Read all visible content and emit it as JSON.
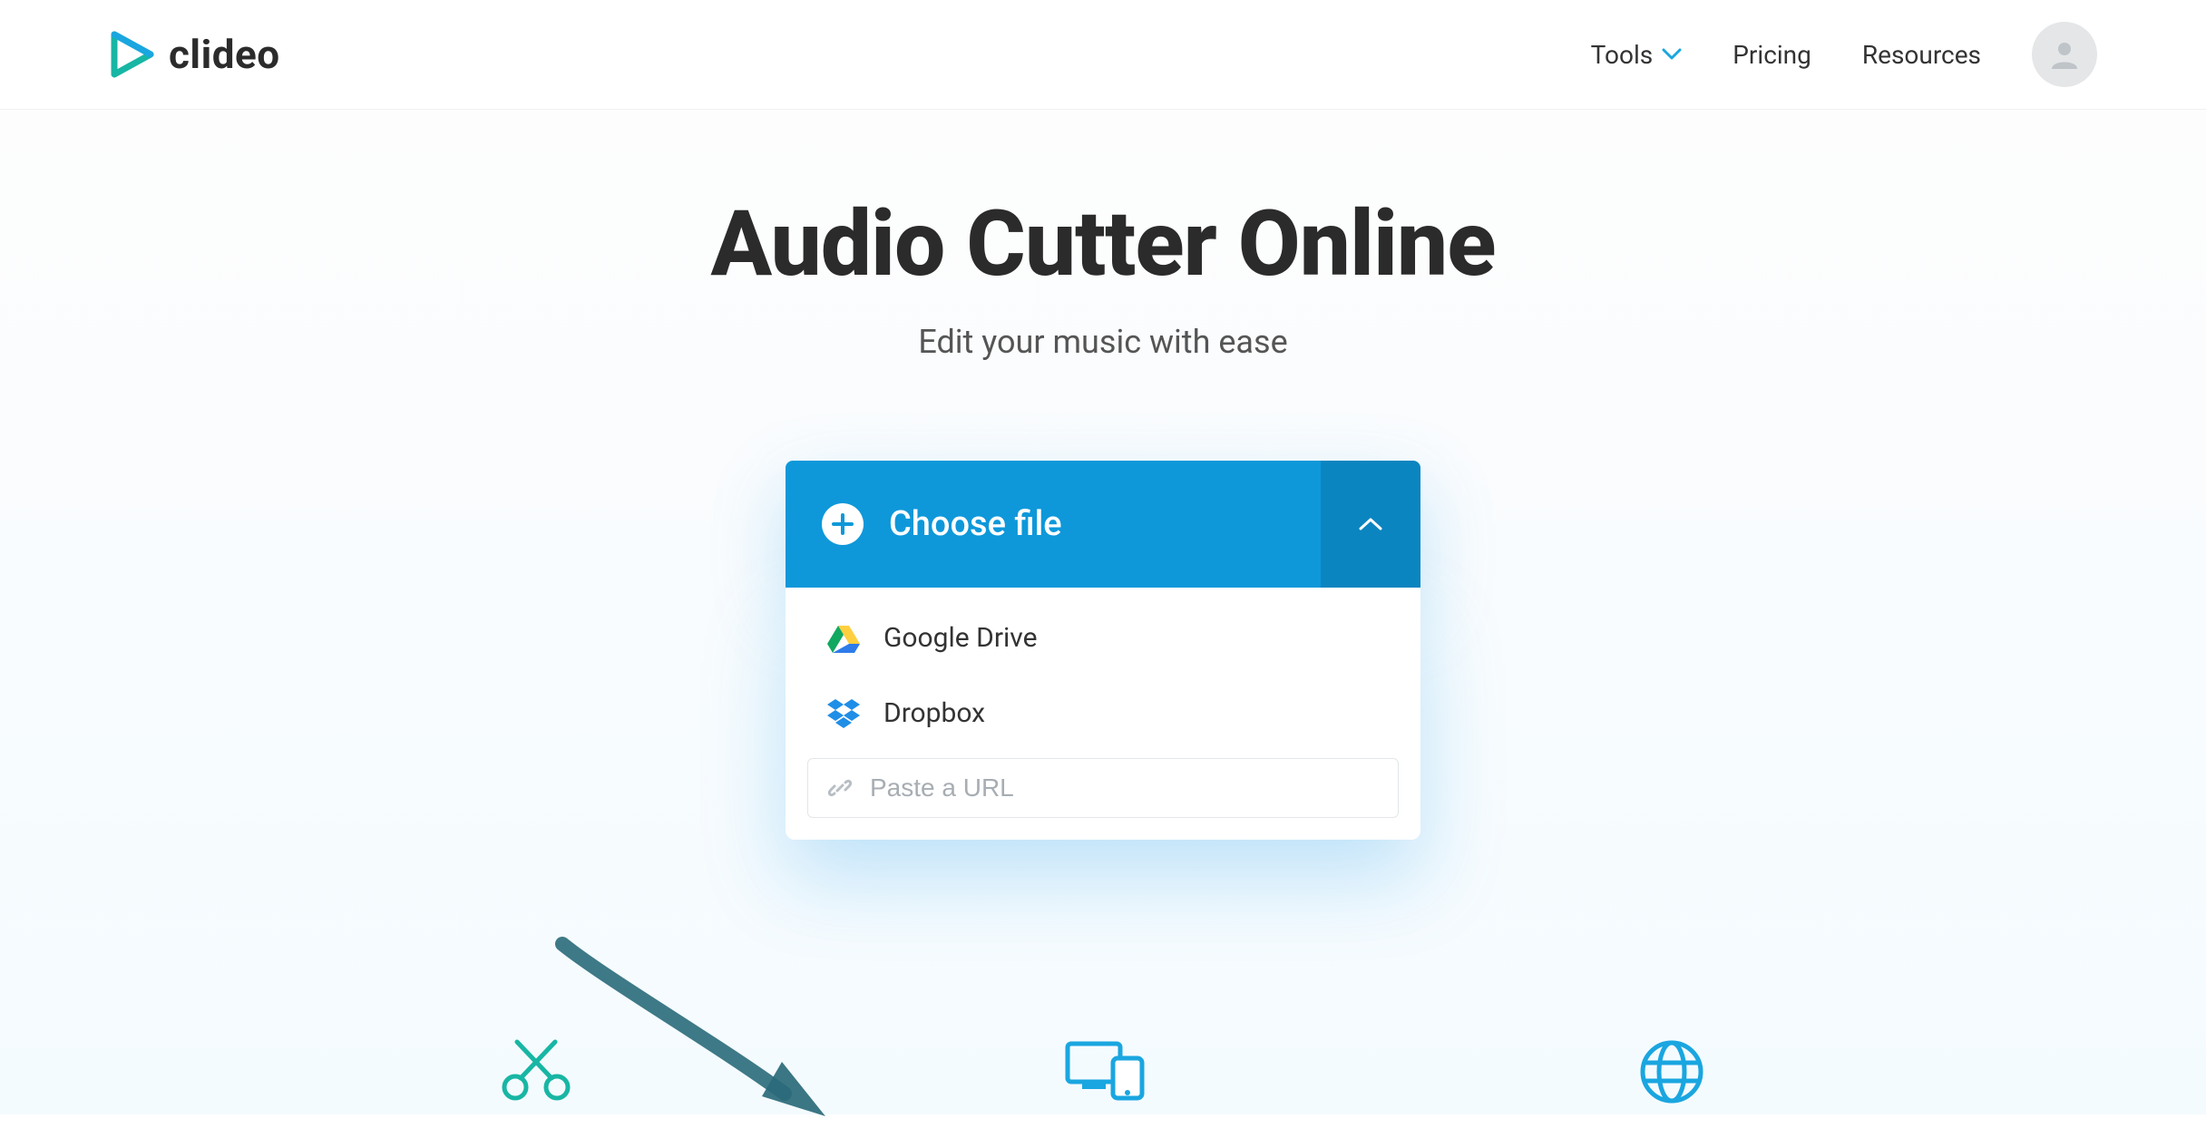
{
  "brand": {
    "name": "clideo"
  },
  "nav": {
    "tools": "Tools",
    "pricing": "Pricing",
    "resources": "Resources"
  },
  "main": {
    "title": "Audio Cutter Online",
    "subtitle": "Edit your music with ease"
  },
  "upload": {
    "choose_label": "Choose file",
    "sources": {
      "google_drive": "Google Drive",
      "dropbox": "Dropbox"
    },
    "url_placeholder": "Paste a URL"
  }
}
